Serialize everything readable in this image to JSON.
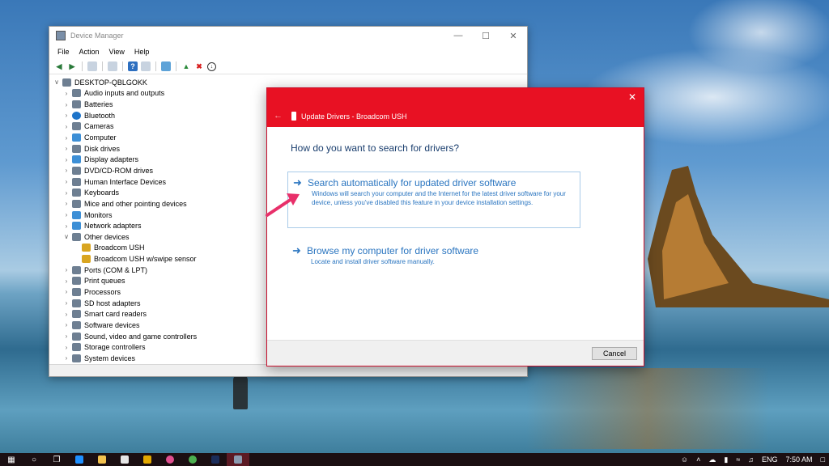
{
  "device_manager": {
    "title": "Device Manager",
    "menu": [
      "File",
      "Action",
      "View",
      "Help"
    ],
    "tree": [
      {
        "label": "DESKTOP-QBLGOKK",
        "level": 0,
        "expanded": true,
        "icon": "computer-icon"
      },
      {
        "label": "Audio inputs and outputs",
        "level": 1,
        "icon": "speaker-icon"
      },
      {
        "label": "Batteries",
        "level": 1,
        "icon": "battery-icon"
      },
      {
        "label": "Bluetooth",
        "level": 1,
        "icon": "bluetooth-icon"
      },
      {
        "label": "Cameras",
        "level": 1,
        "icon": "camera-icon"
      },
      {
        "label": "Computer",
        "level": 1,
        "icon": "monitor-icon"
      },
      {
        "label": "Disk drives",
        "level": 1,
        "icon": "disk-icon"
      },
      {
        "label": "Display adapters",
        "level": 1,
        "icon": "display-icon"
      },
      {
        "label": "DVD/CD-ROM drives",
        "level": 1,
        "icon": "dvd-icon"
      },
      {
        "label": "Human Interface Devices",
        "level": 1,
        "icon": "hid-icon"
      },
      {
        "label": "Keyboards",
        "level": 1,
        "icon": "keyboard-icon"
      },
      {
        "label": "Mice and other pointing devices",
        "level": 1,
        "icon": "mouse-icon"
      },
      {
        "label": "Monitors",
        "level": 1,
        "icon": "monitor-icon"
      },
      {
        "label": "Network adapters",
        "level": 1,
        "icon": "network-icon"
      },
      {
        "label": "Other devices",
        "level": 1,
        "expanded": true,
        "icon": "unknown-device-icon"
      },
      {
        "label": "Broadcom USH",
        "level": 2,
        "icon": "warning-device-icon"
      },
      {
        "label": "Broadcom USH w/swipe sensor",
        "level": 2,
        "icon": "warning-device-icon"
      },
      {
        "label": "Ports (COM & LPT)",
        "level": 1,
        "icon": "port-icon"
      },
      {
        "label": "Print queues",
        "level": 1,
        "icon": "printer-icon"
      },
      {
        "label": "Processors",
        "level": 1,
        "icon": "processor-icon"
      },
      {
        "label": "SD host adapters",
        "level": 1,
        "icon": "sd-card-icon"
      },
      {
        "label": "Smart card readers",
        "level": 1,
        "icon": "smartcard-icon"
      },
      {
        "label": "Software devices",
        "level": 1,
        "icon": "software-icon"
      },
      {
        "label": "Sound, video and game controllers",
        "level": 1,
        "icon": "sound-icon"
      },
      {
        "label": "Storage controllers",
        "level": 1,
        "icon": "storage-icon"
      },
      {
        "label": "System devices",
        "level": 1,
        "icon": "system-icon"
      }
    ]
  },
  "update_drivers": {
    "title": "Update Drivers - Broadcom USH",
    "question": "How do you want to search for drivers?",
    "option1_title": "Search automatically for updated driver software",
    "option1_desc": "Windows will search your computer and the Internet for the latest driver software for your device, unless you've disabled this feature in your device installation settings.",
    "option2_title": "Browse my computer for driver software",
    "option2_desc": "Locate and install driver software manually.",
    "cancel_label": "Cancel",
    "accent_color": "#e81123"
  },
  "taskbar": {
    "language": "ENG",
    "time": "7:50 AM"
  }
}
